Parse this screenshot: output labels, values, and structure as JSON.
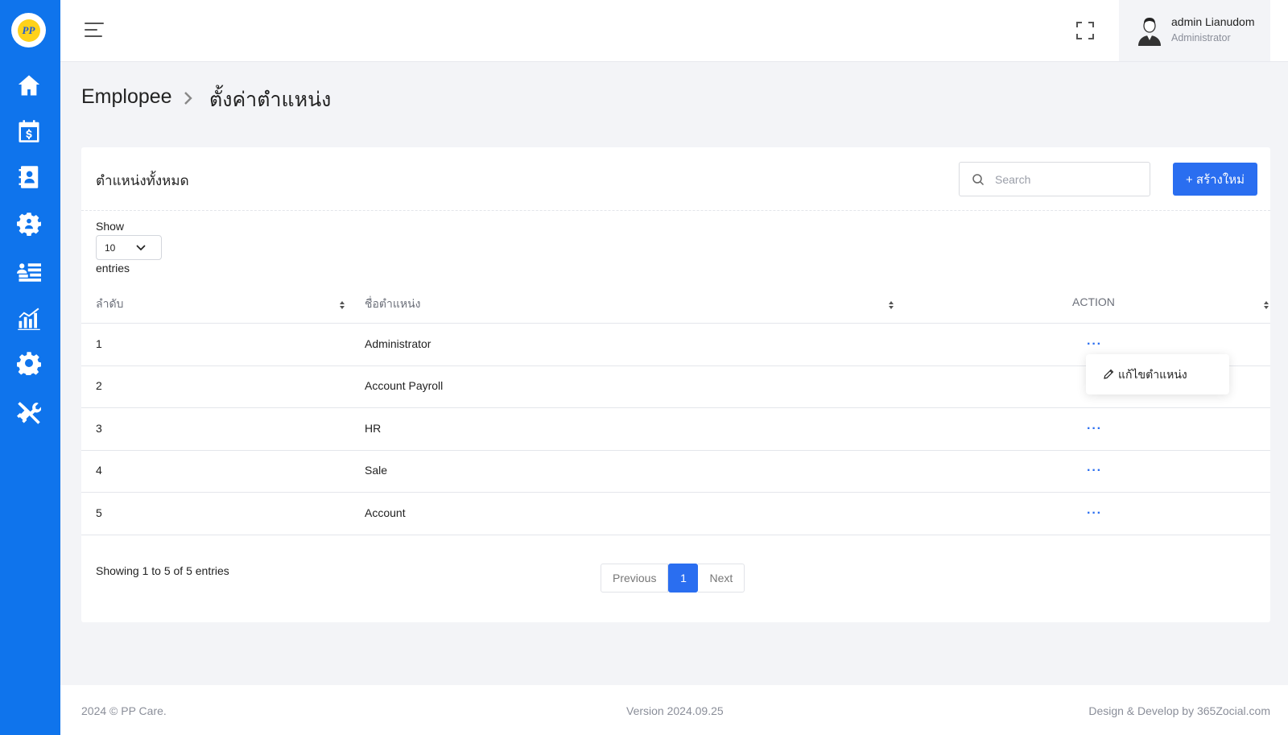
{
  "app": {
    "logo_text": "PP"
  },
  "sidebar": {
    "items": [
      {
        "icon": "home-icon"
      },
      {
        "icon": "calendar-dollar-icon"
      },
      {
        "icon": "contacts-icon"
      },
      {
        "icon": "users-gear-icon"
      },
      {
        "icon": "list-users-icon"
      },
      {
        "icon": "chart-icon"
      },
      {
        "icon": "settings-icon"
      },
      {
        "icon": "tools-icon"
      }
    ],
    "active_index": 7
  },
  "topbar": {
    "user_name": "admin Lianudom",
    "user_role": "Administrator"
  },
  "breadcrumb": {
    "section": "Emplopee",
    "page": "ตั้งค่าตำแหน่ง"
  },
  "card": {
    "title": "ตำแหน่งทั้งหมด",
    "search_placeholder": "Search",
    "create_label": "+ สร้างใหม่",
    "show_label": "Show",
    "page_size": "10",
    "entries_label": "entries",
    "columns": [
      "ลำดับ",
      "ชื่อตำแหน่ง",
      "ACTION"
    ],
    "rows": [
      {
        "no": "1",
        "name": "Administrator"
      },
      {
        "no": "2",
        "name": "Account Payroll"
      },
      {
        "no": "3",
        "name": "HR"
      },
      {
        "no": "4",
        "name": "Sale"
      },
      {
        "no": "5",
        "name": "Account"
      }
    ],
    "action_dots": "···",
    "dropdown_item": "แก้ไขตำแหน่ง",
    "showing": "Showing 1 to 5 of 5 entries",
    "pager": {
      "prev": "Previous",
      "current": "1",
      "next": "Next"
    }
  },
  "footer": {
    "copyright": "2024 © PP Care.",
    "version": "Version 2024.09.25",
    "credit": "Design & Develop by 365Zocial.com"
  },
  "colors": {
    "sidebar": "#0f74ec",
    "primary": "#2a6ef0",
    "background": "#f3f4f7"
  }
}
